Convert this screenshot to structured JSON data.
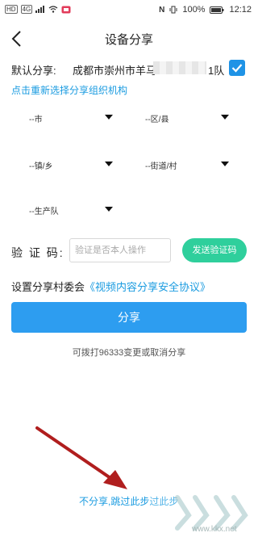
{
  "status_bar": {
    "left_tags": [
      "HD",
      "4G"
    ],
    "battery": "100%",
    "time": "12:12"
  },
  "header": {
    "title": "设备分享"
  },
  "default_share": {
    "label": "默认分享:",
    "value_visible": "成都市崇州市羊马",
    "value_tail": "1队",
    "checked": true
  },
  "reselect_link": "点击重新选择分享组织机构",
  "selects": {
    "city": "--市",
    "district": "--区/县",
    "town": "--镇/乡",
    "street": "--街道/村",
    "team": "--生产队"
  },
  "verify": {
    "label": "验 证 码:",
    "placeholder": "验证是否本人操作",
    "send_button": "发送验证码"
  },
  "committee": {
    "prefix": "设置分享村委会",
    "agreement_link": "《视频内容分享安全协议》"
  },
  "share_button": "分享",
  "tip": "可拨打96333变更或取消分享",
  "skip_link": "不分享,跳过此步",
  "skip_link_overlay": "过此步",
  "watermark_text": "www.kkx.net",
  "accent_colors": {
    "primary": "#2d9df0",
    "green": "#2fcf9c",
    "link": "#1a9be0",
    "arrow": "#b01e1e"
  }
}
